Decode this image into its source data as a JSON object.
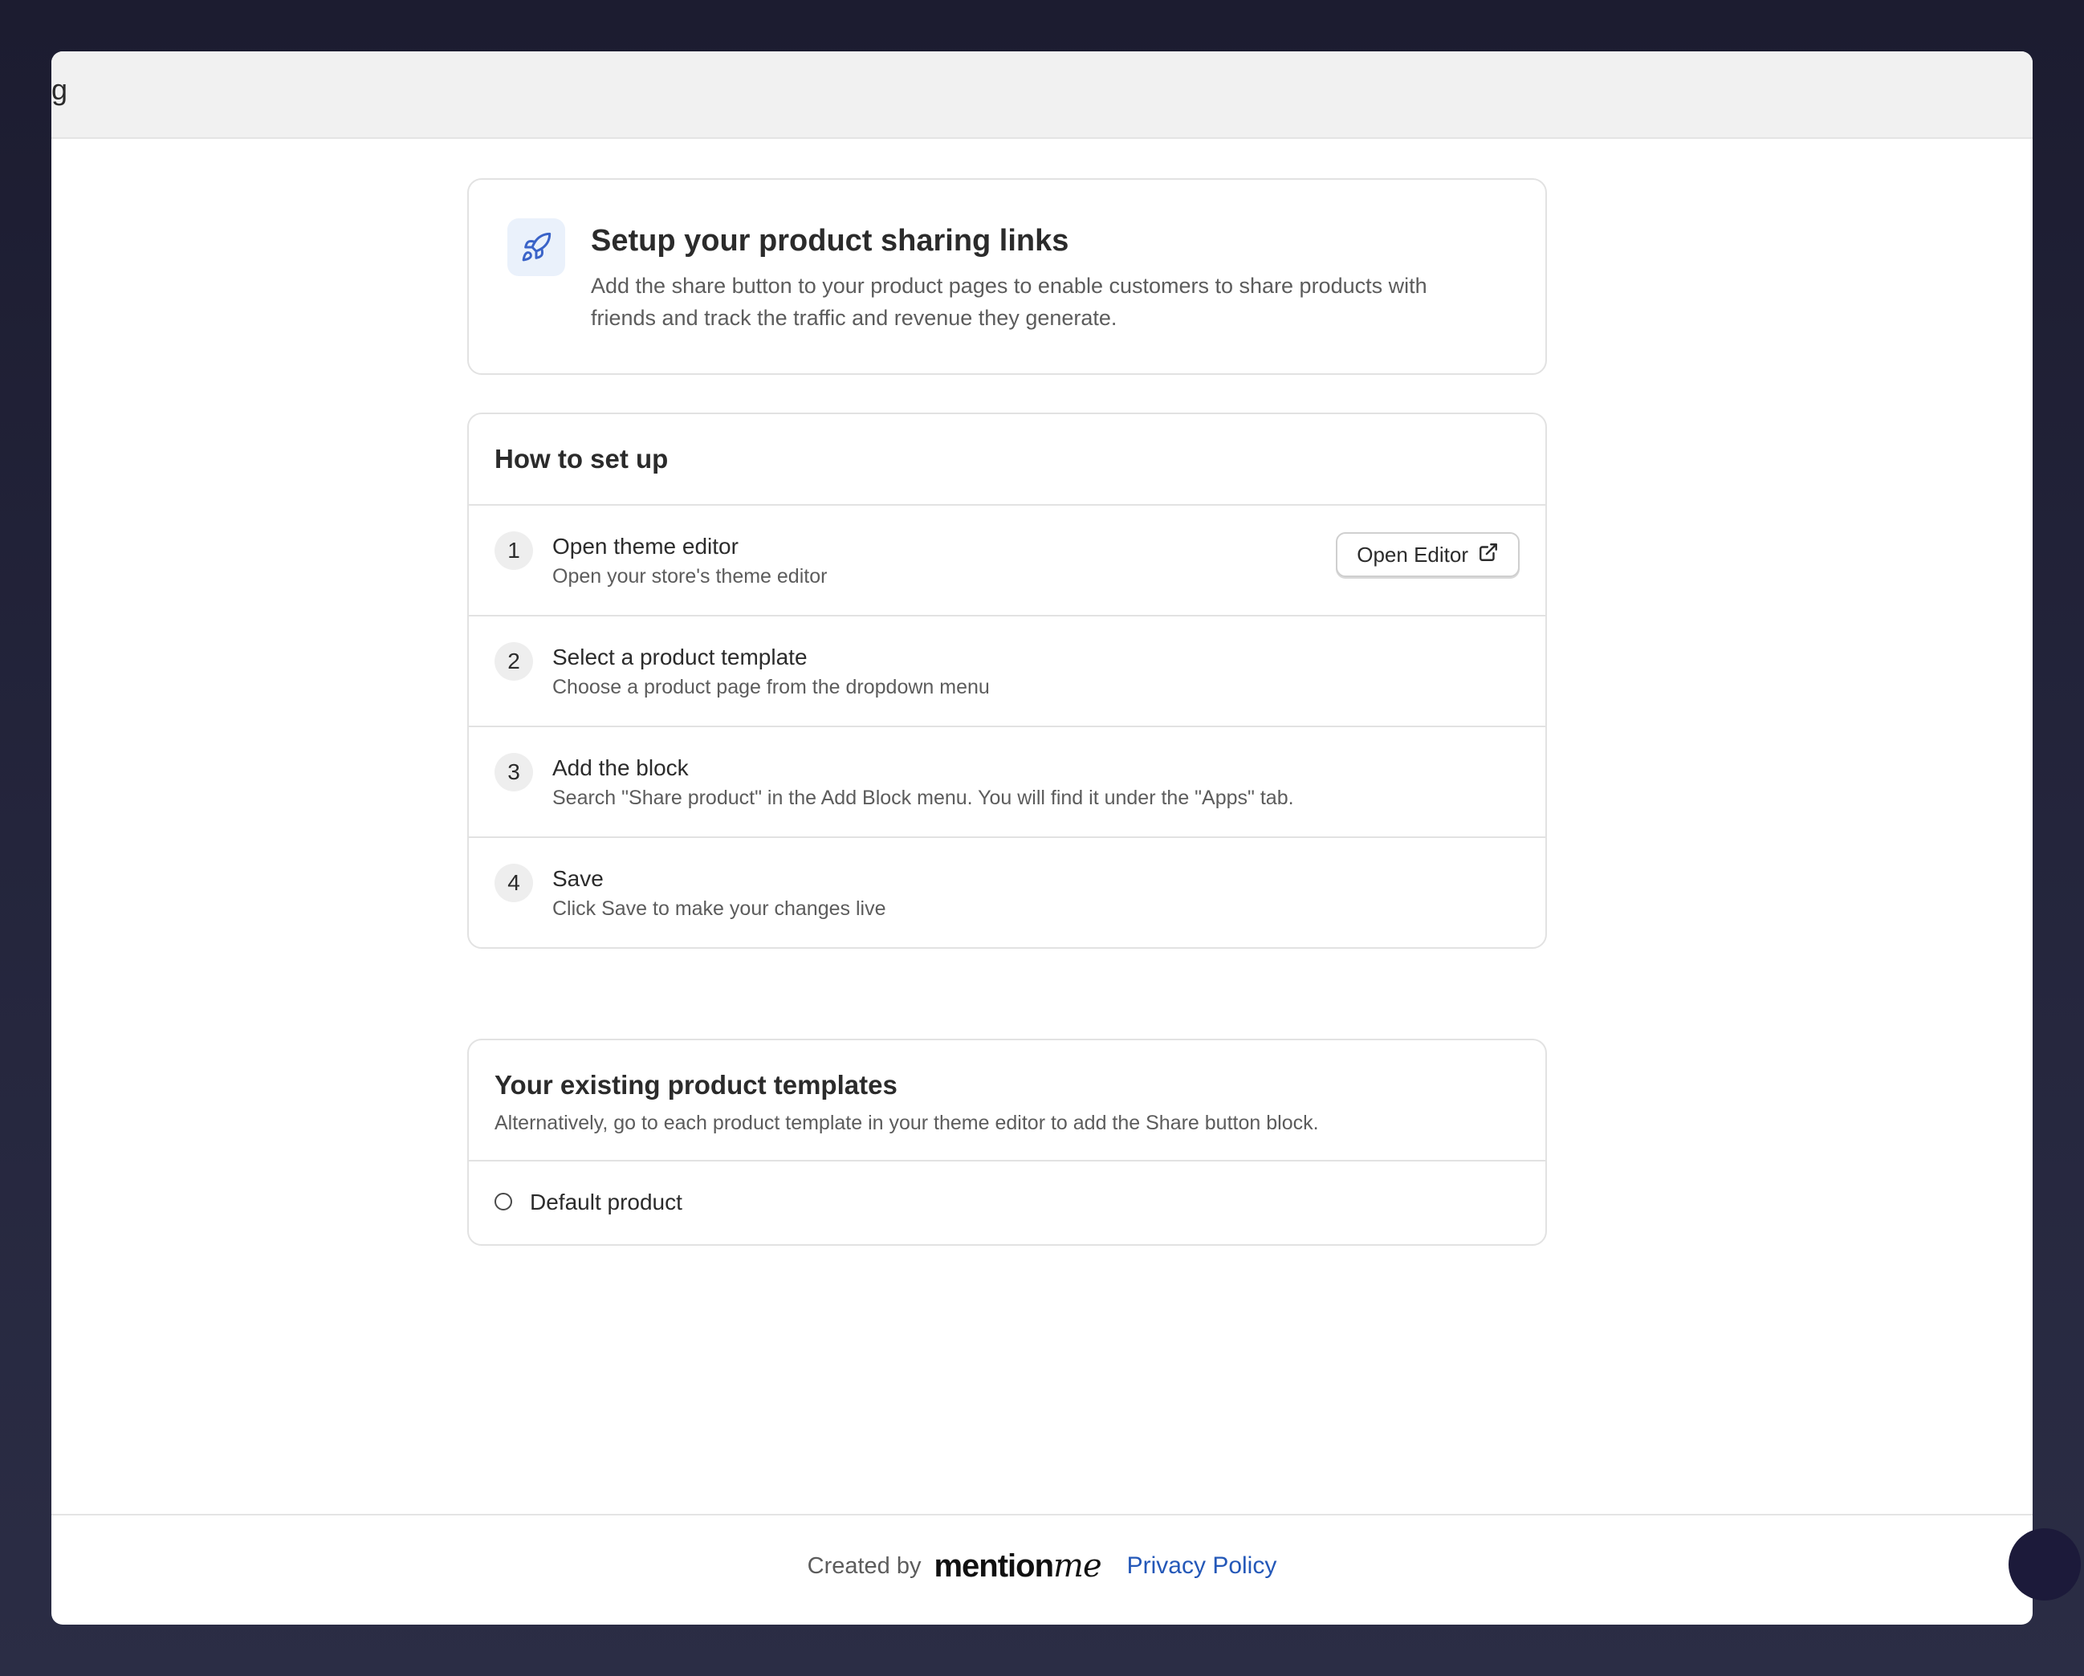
{
  "topbar": {
    "title": "g"
  },
  "hero": {
    "icon": "rocket-icon",
    "title": "Setup your product sharing links",
    "description": "Add the share button to your product pages to enable customers to share products with friends and track the traffic and revenue they generate."
  },
  "setup": {
    "title": "How to set up",
    "steps": [
      {
        "number": "1",
        "title": "Open theme editor",
        "description": "Open your store's theme editor",
        "button_label": "Open Editor",
        "button_icon": "external-link-icon"
      },
      {
        "number": "2",
        "title": "Select a product template",
        "description": "Choose a product page from the dropdown menu"
      },
      {
        "number": "3",
        "title": "Add the block",
        "description": "Search \"Share product\" in the Add Block menu. You will find it under the \"Apps\" tab."
      },
      {
        "number": "4",
        "title": "Save",
        "description": "Click Save to make your changes live"
      }
    ]
  },
  "templates": {
    "title": "Your existing product templates",
    "description": "Alternatively, go to each product template in your theme editor to add the Share button block.",
    "items": [
      {
        "label": "Default product",
        "selected": false
      }
    ]
  },
  "footer": {
    "created_by": "Created by",
    "brand": "mentionme",
    "brand_main": "mention",
    "brand_script": "me",
    "privacy_link": "Privacy Policy"
  },
  "colors": {
    "accent": "#2458b8",
    "icon_bg": "#eaf1fb",
    "text_primary": "#2b2b2b",
    "text_secondary": "#5c5c5c"
  }
}
